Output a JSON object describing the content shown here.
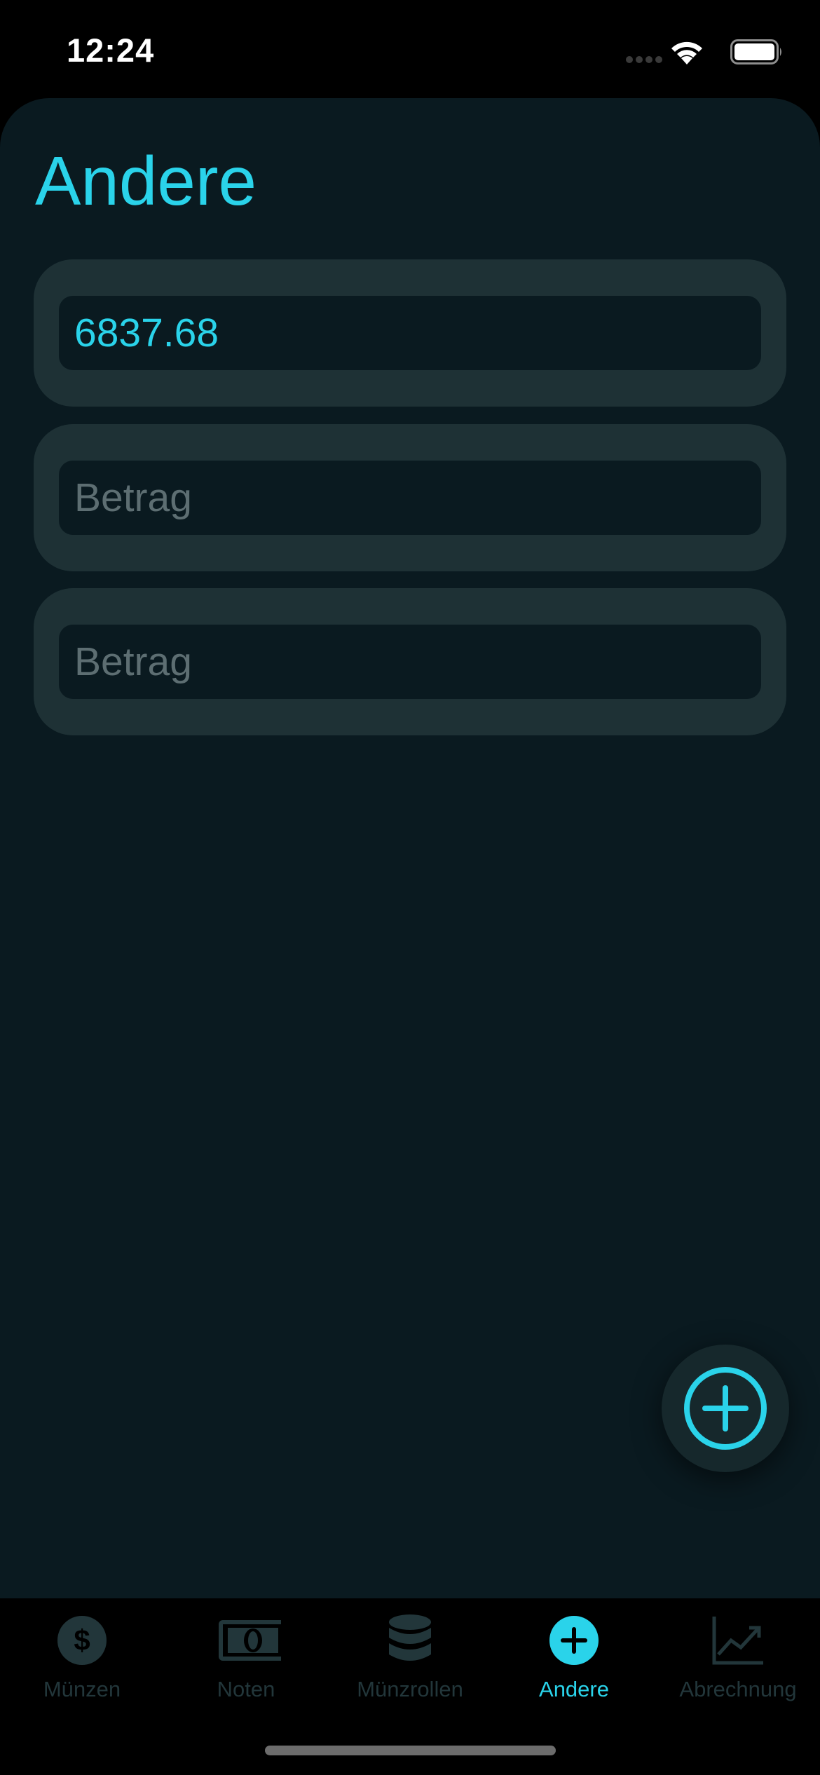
{
  "status_bar": {
    "time": "12:24",
    "icons": [
      "cellular-signal-icon",
      "wifi-icon",
      "battery-icon"
    ]
  },
  "page": {
    "title": "Andere"
  },
  "entries": [
    {
      "value": "6837.68",
      "placeholder": "Betrag"
    },
    {
      "value": "",
      "placeholder": "Betrag"
    },
    {
      "value": "",
      "placeholder": "Betrag"
    }
  ],
  "fab": {
    "icon": "plus-circle-icon"
  },
  "tab_bar": {
    "tabs": [
      {
        "label": "Münzen",
        "icon": "dollar-coin-icon",
        "active": false
      },
      {
        "label": "Noten",
        "icon": "banknote-icon",
        "active": false
      },
      {
        "label": "Münzrollen",
        "icon": "coin-stack-icon",
        "active": false
      },
      {
        "label": "Andere",
        "icon": "plus-circle-icon",
        "active": true
      },
      {
        "label": "Abrechnung",
        "icon": "chart-line-icon",
        "active": false
      }
    ]
  },
  "colors": {
    "accent": "#2ad3ea",
    "background": "#0a1a20",
    "card": "#1e3135",
    "inactive": "#22363a"
  }
}
